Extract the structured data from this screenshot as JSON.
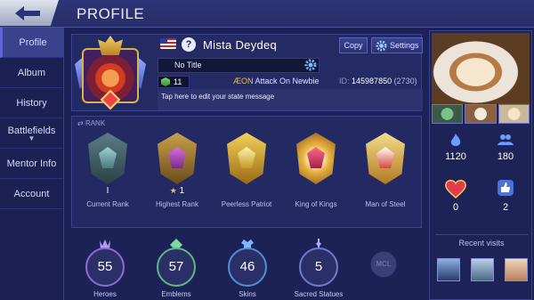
{
  "header": {
    "title": "PROFILE",
    "back_icon": "back-arrow-icon"
  },
  "sidebar": {
    "items": [
      {
        "label": "Profile",
        "active": true
      },
      {
        "label": "Album"
      },
      {
        "label": "History"
      },
      {
        "label": "Battlefields"
      },
      {
        "label": "Mentor Info"
      },
      {
        "label": "Account"
      }
    ]
  },
  "profile": {
    "name": "Mista Deydeq",
    "copy_label": "Copy",
    "settings_label": "Settings",
    "title_text": "No Title",
    "level": "11",
    "squad_tag": "ÆON",
    "squad_name": "Attack On Newbie",
    "id_label": "ID:",
    "id_value": "145987850",
    "id_rank": "(2730)",
    "state_message": "Tap here to edit your state message"
  },
  "rank": {
    "header": "RANK",
    "items": [
      {
        "label": "Current Rank",
        "sub": "I"
      },
      {
        "label": "Highest Rank",
        "sub": "1"
      },
      {
        "label": "Peerless Patriot",
        "sub": ""
      },
      {
        "label": "King of Kings",
        "sub": ""
      },
      {
        "label": "Man of Steel",
        "sub": ""
      }
    ]
  },
  "stats": {
    "items": [
      {
        "label": "Heroes",
        "value": "55"
      },
      {
        "label": "Emblems",
        "value": "57"
      },
      {
        "label": "Skins",
        "value": "46"
      },
      {
        "label": "Sacred Statues",
        "value": "5"
      }
    ],
    "badge_text": "MCL"
  },
  "social": {
    "followers": "1120",
    "following": "180",
    "likes": "0",
    "thumbs": "2"
  },
  "recent_visits": {
    "header": "Recent visits"
  },
  "colors": {
    "ring_heroes": "#8d6bd6",
    "ring_emblems": "#5fb87e",
    "ring_skins": "#4f8fd6",
    "ring_statues": "#6f7bd0"
  }
}
